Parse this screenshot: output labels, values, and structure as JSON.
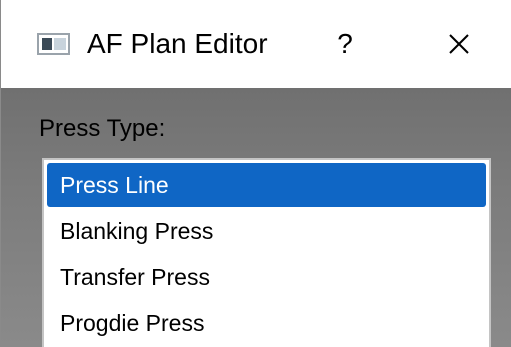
{
  "window": {
    "title": "AF Plan Editor",
    "help_glyph": "?",
    "close_icon": "close-icon",
    "app_icon": "window-app-icon"
  },
  "form": {
    "press_type_label": "Press Type:"
  },
  "press_type_dropdown": {
    "options": [
      {
        "label": "Press Line",
        "selected": true
      },
      {
        "label": "Blanking Press",
        "selected": false
      },
      {
        "label": "Transfer Press",
        "selected": false
      },
      {
        "label": "Progdie Press",
        "selected": false
      }
    ]
  },
  "colors": {
    "selection": "#0f66c5",
    "dialog_body": "#7a7a7a"
  }
}
